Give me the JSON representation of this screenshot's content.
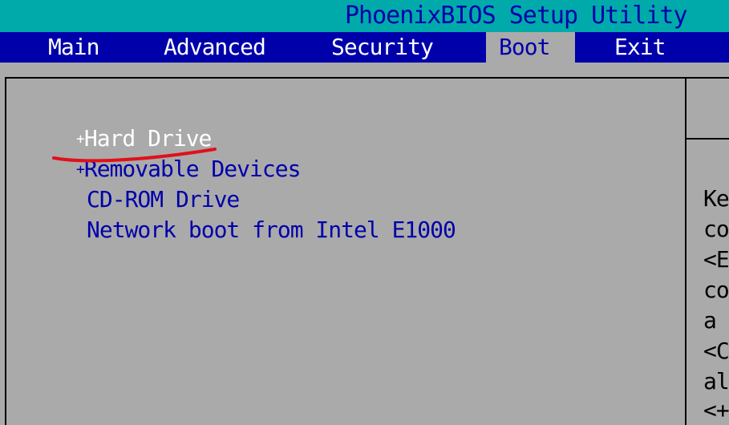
{
  "title": "PhoenixBIOS Setup Utility",
  "menu": [
    {
      "label": "Main",
      "active": false
    },
    {
      "label": "Advanced",
      "active": false
    },
    {
      "label": "Security",
      "active": false
    },
    {
      "label": "Boot",
      "active": true
    },
    {
      "label": "Exit",
      "active": false
    }
  ],
  "boot_items": [
    {
      "prefix": "+",
      "label": "Hard Drive",
      "selected": true
    },
    {
      "prefix": "+",
      "label": "Removable Devices",
      "selected": false
    },
    {
      "prefix": "",
      "label": "CD-ROM Drive",
      "selected": false
    },
    {
      "prefix": "",
      "label": "Network boot from Intel E1000",
      "selected": false
    }
  ],
  "help_text": [
    "Ke",
    "co",
    "<E",
    "co",
    "a",
    "<C",
    "al",
    "<+"
  ],
  "colors": {
    "title_bg": "#00aaaa",
    "menu_bg": "#0000aa",
    "panel_bg": "#aaaaaa",
    "item_text": "#0000aa",
    "selected_text": "#ffffff",
    "annotation_stroke": "#e0101a"
  }
}
